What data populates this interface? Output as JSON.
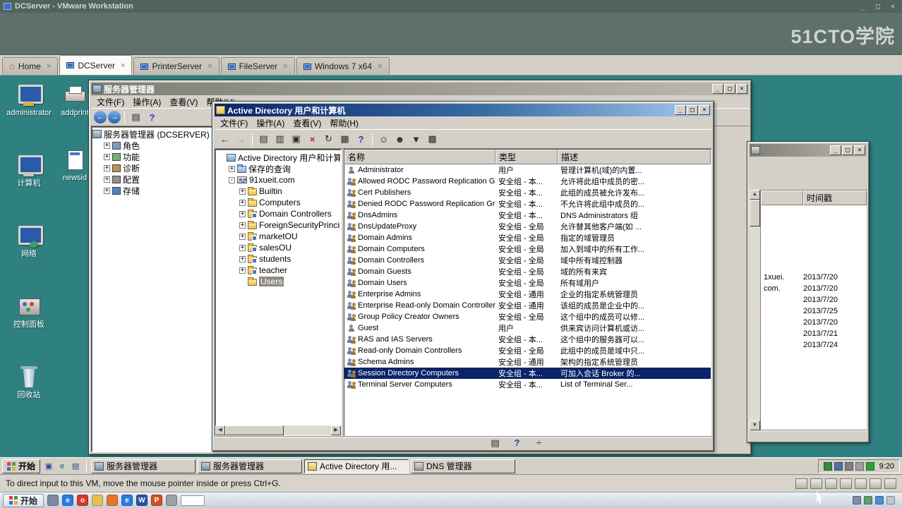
{
  "win_controls": {
    "minimize": "_",
    "maximize": "□",
    "close": "×"
  },
  "vmware": {
    "title": "DCServer - VMware Workstation",
    "watermark": "51CTO学院",
    "tabs": [
      {
        "label": "Home",
        "icon": "home",
        "active": false
      },
      {
        "label": "DCServer",
        "icon": "vm",
        "active": true
      },
      {
        "label": "PrinterServer",
        "icon": "vm",
        "active": false
      },
      {
        "label": "FileServer",
        "icon": "vm",
        "active": false
      },
      {
        "label": "Windows 7 x64",
        "icon": "vm",
        "active": false
      }
    ],
    "status_text": "To direct input to this VM, move the mouse pointer inside or press Ctrl+G.",
    "status_icons": [
      {
        "name": "hdd-icon"
      },
      {
        "name": "cdrom-icon"
      },
      {
        "name": "floppy-icon"
      },
      {
        "name": "network-adapter-icon"
      },
      {
        "name": "usb-icon"
      },
      {
        "name": "sound-icon"
      },
      {
        "name": "display-icon"
      }
    ]
  },
  "desktop": {
    "columns": [
      [
        {
          "label": "administrator",
          "name": "administrator",
          "icon": "ic-admin"
        },
        {
          "label": "计算机",
          "name": "computer",
          "icon": "ic-computer"
        },
        {
          "label": "网络",
          "name": "network",
          "icon": "ic-network"
        },
        {
          "label": "控制面板",
          "name": "control-panel",
          "icon": "ic-cpanel"
        },
        {
          "label": "回收站",
          "name": "recycle-bin",
          "icon": "ic-recycle"
        }
      ],
      [
        {
          "label": "addprint",
          "name": "addprinter",
          "icon": "ic-printer"
        },
        {
          "label": "newsid",
          "name": "newsid",
          "icon": "ic-newsid"
        }
      ]
    ]
  },
  "server_manager": {
    "title": "服务器管理器",
    "menu": [
      {
        "label": "文件(F)",
        "name": "file"
      },
      {
        "label": "操作(A)",
        "name": "action"
      },
      {
        "label": "查看(V)",
        "name": "view"
      },
      {
        "label": "帮助(H)",
        "name": "help"
      }
    ],
    "toolbar": [
      {
        "name": "back-icon",
        "glyph": "←",
        "round": true
      },
      {
        "name": "forward-icon",
        "glyph": "→",
        "round": true
      },
      {
        "name": "separator"
      },
      {
        "name": "show-console-tree-icon",
        "glyph": "▤"
      },
      {
        "name": "help-icon",
        "glyph": "?",
        "tint": "blue"
      }
    ],
    "tree_root": "服务器管理器 (DCSERVER)",
    "tree_items": [
      {
        "label": "角色",
        "name": "roles",
        "color": "#7a9ad0"
      },
      {
        "label": "功能",
        "name": "features",
        "color": "#70b070"
      },
      {
        "label": "诊断",
        "name": "diagnostics",
        "color": "#c09050"
      },
      {
        "label": "配置",
        "name": "configuration",
        "color": "#909090"
      },
      {
        "label": "存储",
        "name": "storage",
        "color": "#5080c0"
      }
    ]
  },
  "ad_window": {
    "title": "Active Directory 用户和计算机",
    "menu": [
      {
        "label": "文件(F)",
        "name": "file"
      },
      {
        "label": "操作(A)",
        "name": "action"
      },
      {
        "label": "查看(V)",
        "name": "view"
      },
      {
        "label": "帮助(H)",
        "name": "help"
      }
    ],
    "toolbar": [
      {
        "name": "back-icon",
        "glyph": "←",
        "tint": "dark"
      },
      {
        "name": "forward-icon",
        "glyph": "→",
        "tint": "gray"
      },
      {
        "name": "separator"
      },
      {
        "name": "show-console-tree-icon",
        "glyph": "▤"
      },
      {
        "name": "properties-icon",
        "glyph": "▥"
      },
      {
        "name": "copy-icon",
        "glyph": "▣"
      },
      {
        "name": "delete-icon",
        "glyph": "×",
        "tint": "red"
      },
      {
        "name": "refresh-icon",
        "glyph": "↻"
      },
      {
        "name": "export-list-icon",
        "glyph": "▦"
      },
      {
        "name": "help-icon",
        "glyph": "?",
        "tint": "blue"
      },
      {
        "name": "separator"
      },
      {
        "name": "new-user-icon",
        "glyph": "☺"
      },
      {
        "name": "new-group-icon",
        "glyph": "☻"
      },
      {
        "name": "filter-icon",
        "glyph": "▼"
      },
      {
        "name": "view-columns-icon",
        "glyph": "▩"
      }
    ],
    "tree": [
      {
        "label": "Active Directory 用户和计算机",
        "name": "ad-root",
        "depth": 0,
        "icon": "i-root",
        "expander": ""
      },
      {
        "label": "保存的查询",
        "name": "saved-queries",
        "depth": 1,
        "icon": "i-query",
        "expander": "+"
      },
      {
        "label": "91xueit.com",
        "name": "domain-91xueit-com",
        "depth": 1,
        "icon": "i-domain",
        "expander": "-"
      },
      {
        "label": "Builtin",
        "name": "builtin",
        "depth": 2,
        "icon": "i-folder",
        "expander": "+"
      },
      {
        "label": "Computers",
        "name": "computers",
        "depth": 2,
        "icon": "i-folder",
        "expander": "+"
      },
      {
        "label": "Domain Controllers",
        "name": "domain-controllers",
        "depth": 2,
        "icon": "i-ou",
        "expander": "+"
      },
      {
        "label": "ForeignSecurityPrincipals",
        "name": "foreign-security-principals",
        "depth": 2,
        "icon": "i-folder",
        "expander": "+"
      },
      {
        "label": "marketOU",
        "name": "market-ou",
        "depth": 2,
        "icon": "i-ou",
        "expander": "+"
      },
      {
        "label": "salesOU",
        "name": "sales-ou",
        "depth": 2,
        "icon": "i-ou",
        "expander": "+"
      },
      {
        "label": "students",
        "name": "students",
        "depth": 2,
        "icon": "i-ou",
        "expander": "+"
      },
      {
        "label": "teacher",
        "name": "teacher",
        "depth": 2,
        "icon": "i-ou",
        "expander": "+"
      },
      {
        "label": "Users",
        "name": "users",
        "depth": 2,
        "icon": "i-folder",
        "expander": "",
        "selected": true
      }
    ],
    "columns": [
      {
        "label": "名称",
        "name": "name"
      },
      {
        "label": "类型",
        "name": "type"
      },
      {
        "label": "描述",
        "name": "description"
      }
    ],
    "rows": [
      {
        "icon": "user",
        "name": "Administrator",
        "type": "用户",
        "desc": "管理计算机(域)的内置..."
      },
      {
        "icon": "group",
        "name": "Allowed RODC Password Replication Group",
        "type": "安全组 - 本...",
        "desc": "允许将此组中成员的密..."
      },
      {
        "icon": "group",
        "name": "Cert Publishers",
        "type": "安全组 - 本...",
        "desc": "此组的成员被允许发布..."
      },
      {
        "icon": "group",
        "name": "Denied RODC Password Replication Group",
        "type": "安全组 - 本...",
        "desc": "不允许将此组中成员的..."
      },
      {
        "icon": "group",
        "name": "DnsAdmins",
        "type": "安全组 - 本...",
        "desc": "DNS Administrators 组"
      },
      {
        "icon": "group",
        "name": "DnsUpdateProxy",
        "type": "安全组 - 全局",
        "desc": "允许替其他客户端(如 ..."
      },
      {
        "icon": "group",
        "name": "Domain Admins",
        "type": "安全组 - 全局",
        "desc": "指定的域管理员"
      },
      {
        "icon": "group",
        "name": "Domain Computers",
        "type": "安全组 - 全局",
        "desc": "加入到域中的所有工作..."
      },
      {
        "icon": "group",
        "name": "Domain Controllers",
        "type": "安全组 - 全局",
        "desc": "域中所有域控制器"
      },
      {
        "icon": "group",
        "name": "Domain Guests",
        "type": "安全组 - 全局",
        "desc": "域的所有来宾"
      },
      {
        "icon": "group",
        "name": "Domain Users",
        "type": "安全组 - 全局",
        "desc": "所有域用户"
      },
      {
        "icon": "group",
        "name": "Enterprise Admins",
        "type": "安全组 - 通用",
        "desc": "企业的指定系统管理员"
      },
      {
        "icon": "group",
        "name": "Enterprise Read-only Domain Controllers",
        "type": "安全组 - 通用",
        "desc": "该组的成员是企业中的..."
      },
      {
        "icon": "group",
        "name": "Group Policy Creator Owners",
        "type": "安全组 - 全局",
        "desc": "这个组中的成员可以修..."
      },
      {
        "icon": "user",
        "name": "Guest",
        "type": "用户",
        "desc": "供来宾访问计算机或访..."
      },
      {
        "icon": "group",
        "name": "RAS and IAS Servers",
        "type": "安全组 - 本...",
        "desc": "这个组中的服务器可以..."
      },
      {
        "icon": "group",
        "name": "Read-only Domain Controllers",
        "type": "安全组 - 全局",
        "desc": "此组中的成员是域中只..."
      },
      {
        "icon": "group",
        "name": "Schema Admins",
        "type": "安全组 - 通用",
        "desc": "架构的指定系统管理员"
      },
      {
        "icon": "group",
        "name": "Session Directory Computers",
        "type": "安全组 - 本...",
        "desc": "可加入会话 Broker 的...",
        "selected": true
      },
      {
        "icon": "group",
        "name": "Terminal Server Computers",
        "type": "安全组 - 本...",
        "desc": "List of Terminal Ser..."
      }
    ],
    "status_icons": [
      {
        "name": "print-icon",
        "glyph": "▤"
      },
      {
        "name": "help-icon",
        "glyph": "?",
        "tint": "blue"
      },
      {
        "name": "more-icon",
        "glyph": "÷"
      }
    ]
  },
  "dns_window": {
    "timestamp_header": "时间戳",
    "rows": [
      {
        "name": "1xuei.",
        "timestamp": "2013/7/20"
      },
      {
        "name": "com.",
        "timestamp": "2013/7/20"
      },
      {
        "name": "",
        "timestamp": "2013/7/20"
      },
      {
        "name": "",
        "timestamp": "2013/7/25"
      },
      {
        "name": "",
        "timestamp": "2013/7/20"
      },
      {
        "name": "",
        "timestamp": "2013/7/21"
      },
      {
        "name": "",
        "timestamp": "2013/7/24"
      }
    ]
  },
  "vm_taskbar": {
    "start_label": "开始",
    "quick_launch": [
      {
        "name": "show-desktop-icon",
        "glyph": "▣"
      },
      {
        "name": "ie-icon",
        "glyph": "e"
      },
      {
        "name": "explorer-icon",
        "glyph": "▤"
      }
    ],
    "buttons": [
      {
        "label": "服务器管理器",
        "name": "server-manager-1",
        "icon": "ti-sm2",
        "active": false
      },
      {
        "label": "服务器管理器",
        "name": "server-manager-2",
        "icon": "ti-sm2",
        "active": false
      },
      {
        "label": "Active Directory 用...",
        "name": "active-directory",
        "icon": "ti-ad2",
        "active": true
      },
      {
        "label": "DNS 管理器",
        "name": "dns-manager",
        "icon": "ti-dns2",
        "active": false
      }
    ],
    "tray_icons": [
      {
        "name": "vmware-tools-icon",
        "color": "#3a8a3a"
      },
      {
        "name": "network-icon",
        "color": "#5070a0"
      },
      {
        "name": "volume-icon",
        "color": "#808080"
      },
      {
        "name": "server-status-icon",
        "color": "#a0a0a0"
      },
      {
        "name": "shield-icon",
        "color": "#30a030"
      }
    ],
    "clock": "9:20"
  },
  "host_taskbar": {
    "start_label": "开始",
    "icons": [
      {
        "name": "show-desktop-icon",
        "color": "#7a8aa0",
        "glyph": ""
      },
      {
        "name": "ie-icon",
        "color": "#2a7ae0",
        "glyph": "e"
      },
      {
        "name": "media-player-icon",
        "color": "#d43a2a",
        "glyph": "o"
      },
      {
        "name": "folder-icon",
        "color": "#e6c050",
        "glyph": ""
      },
      {
        "name": "firefox-icon",
        "color": "#e8762a",
        "glyph": ""
      },
      {
        "name": "ie-icon-2",
        "color": "#2a7ae0",
        "glyph": "e"
      },
      {
        "name": "word-icon",
        "color": "#2a50a0",
        "glyph": "W"
      },
      {
        "name": "powerpoint-icon",
        "color": "#d05020",
        "glyph": "P"
      },
      {
        "name": "printer-icon",
        "color": "#9aa0a8",
        "glyph": ""
      },
      {
        "name": "language-indicator",
        "color": "#ffffff",
        "glyph": ""
      }
    ],
    "tray_icons": [
      {
        "name": "volume-icon",
        "color": "#8090a8"
      },
      {
        "name": "network-icon",
        "color": "#60a070"
      },
      {
        "name": "update-icon",
        "color": "#4a90d9"
      },
      {
        "name": "ime-icon",
        "color": "#c0c8d4"
      }
    ]
  }
}
